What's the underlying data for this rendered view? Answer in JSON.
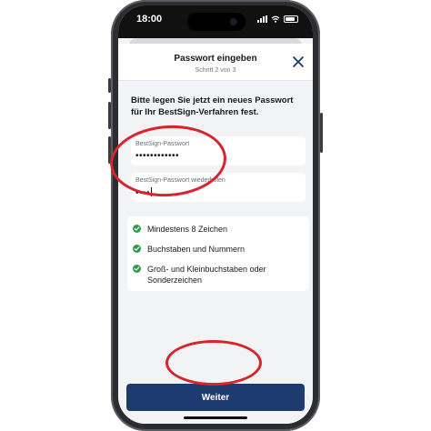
{
  "status_bar": {
    "time": "18:00"
  },
  "header": {
    "title": "Passwort eingeben",
    "subtitle": "Schritt 2 von 3",
    "close_icon": "close-icon"
  },
  "instruction": "Bitte legen Sie jetzt ein neues Passwort für Ihr BestSign-Verfahren fest.",
  "fields": [
    {
      "label": "BestSign-Passwort",
      "value": "••••••••••••"
    },
    {
      "label": "BestSign-Passwort wiederholen",
      "value": "••••"
    }
  ],
  "requirements": [
    {
      "text": "Mindestens 8 Zeichen",
      "icon": "check-circle-icon",
      "color": "#2e9b4c"
    },
    {
      "text": "Buchstaben und Nummern",
      "icon": "check-circle-icon",
      "color": "#2e9b4c"
    },
    {
      "text": "Groß- und Kleinbuchstaben oder Sonderzeichen",
      "icon": "check-circle-icon",
      "color": "#2e9b4c"
    }
  ],
  "primary_button": {
    "label": "Weiter",
    "color": "#1e3b70"
  },
  "annotation_color": "#d9232d"
}
